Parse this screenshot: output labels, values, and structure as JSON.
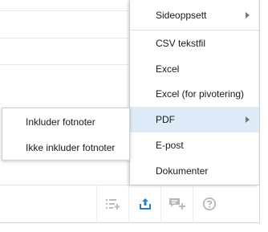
{
  "menu": {
    "items": [
      {
        "label": "Sideoppsett",
        "submenu": true
      },
      {
        "label": "CSV tekstfil",
        "submenu": false
      },
      {
        "label": "Excel",
        "submenu": false
      },
      {
        "label": "Excel (for pivotering)",
        "submenu": false
      },
      {
        "label": "PDF",
        "submenu": true,
        "active": true
      },
      {
        "label": "E-post",
        "submenu": false
      },
      {
        "label": "Dokumenter",
        "submenu": false
      }
    ]
  },
  "submenu": {
    "items": [
      {
        "label": "Inkluder fotnoter"
      },
      {
        "label": "Ikke inkluder fotnoter"
      }
    ]
  },
  "toolbar": {
    "buttons": [
      {
        "icon": "list-add-icon",
        "active": false
      },
      {
        "icon": "export-icon",
        "active": true
      },
      {
        "icon": "comment-add-icon",
        "active": false
      },
      {
        "icon": "help-icon",
        "active": false
      }
    ]
  },
  "colors": {
    "accent": "#2a7fc4",
    "highlight": "#dcebf7",
    "icon_muted": "#b8b8b8"
  }
}
